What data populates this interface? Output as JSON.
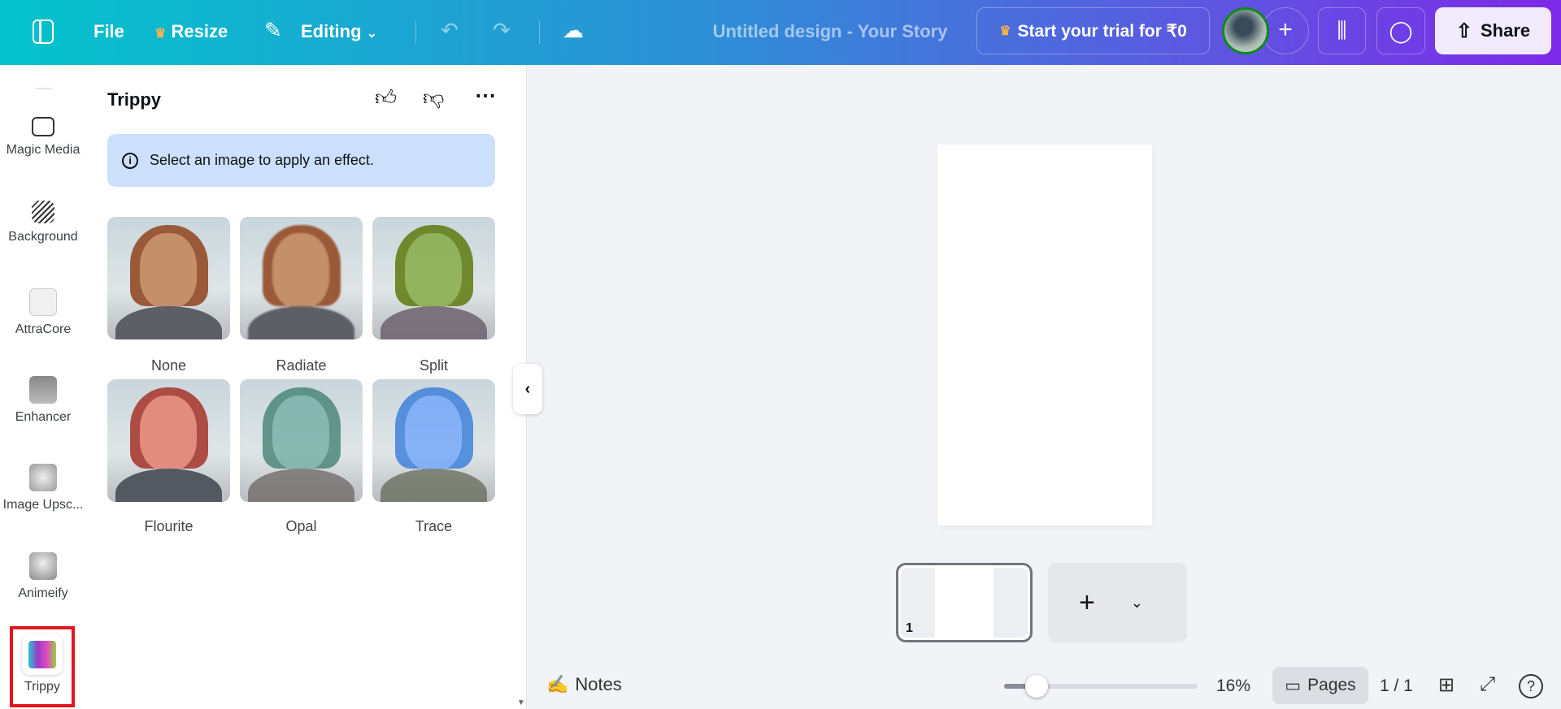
{
  "header": {
    "file": "File",
    "resize": "Resize",
    "editing": "Editing",
    "title": "Untitled design - Your Story",
    "trial": "Start your trial for ₹0",
    "share": "Share"
  },
  "sidebar": {
    "items": [
      {
        "label": "Magic Media"
      },
      {
        "label": "Background"
      },
      {
        "label": "AttraCore"
      },
      {
        "label": "Enhancer"
      },
      {
        "label": "Image Upsc..."
      },
      {
        "label": "Animeify"
      },
      {
        "label": "Trippy"
      }
    ]
  },
  "panel": {
    "title": "Trippy",
    "info": "Select an image to apply an effect.",
    "effects": [
      {
        "label": "None"
      },
      {
        "label": "Radiate"
      },
      {
        "label": "Split"
      },
      {
        "label": "Flourite"
      },
      {
        "label": "Opal"
      },
      {
        "label": "Trace"
      }
    ]
  },
  "canvas": {
    "page_number": "1"
  },
  "footer": {
    "notes": "Notes",
    "zoom": "16%",
    "zoom_value": 16,
    "pages": "Pages",
    "page_count": "1 / 1"
  }
}
